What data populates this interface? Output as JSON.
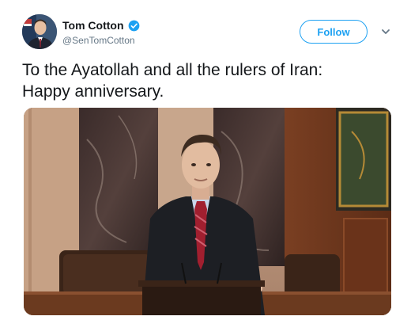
{
  "author": {
    "name": "Tom Cotton",
    "handle": "@SenTomCotton",
    "verified": true
  },
  "actions": {
    "follow_label": "Follow"
  },
  "tweet": {
    "line1": "To the Ayatollah and all the rulers of Iran:",
    "line2": "Happy anniversary."
  },
  "colors": {
    "accent": "#1da1f2",
    "text": "#14171a",
    "secondary": "#657786"
  },
  "icons": {
    "verified": "verified-badge-icon",
    "caret": "chevron-down-icon"
  }
}
